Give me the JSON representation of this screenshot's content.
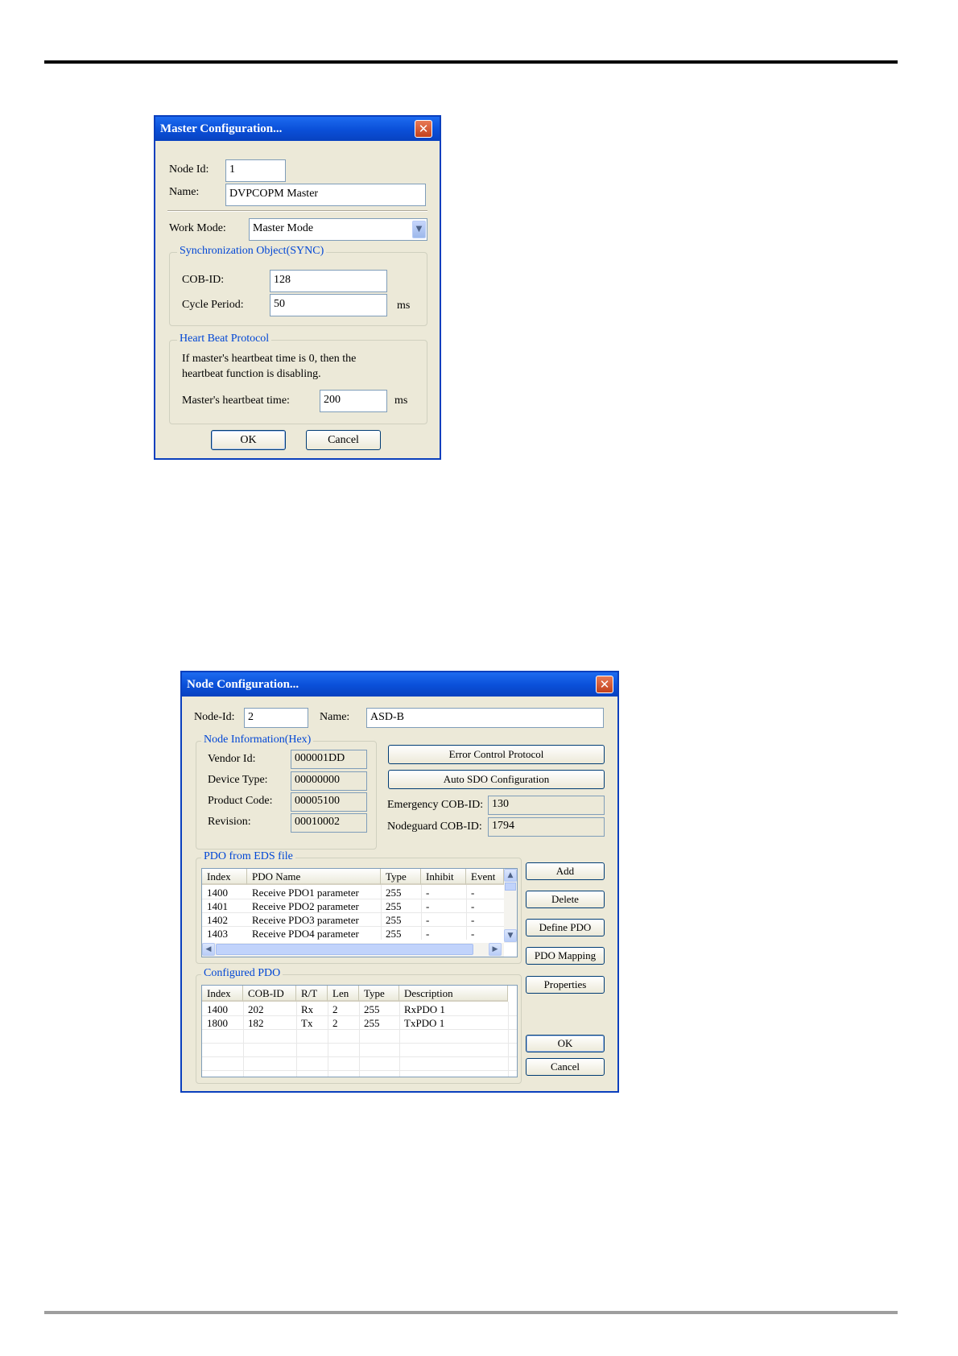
{
  "master_dialog": {
    "title": "Master Configuration...",
    "close_symbol": "✕",
    "node_id_label": "Node Id:",
    "node_id_value": "1",
    "name_label": "Name:",
    "name_value": "DVPCOPM Master",
    "work_mode_label": "Work Mode:",
    "work_mode_value": "Master Mode",
    "sync_group_title": "Synchronization Object(SYNC)",
    "cob_id_label": "COB-ID:",
    "cob_id_value": "128",
    "cycle_period_label": "Cycle Period:",
    "cycle_period_value": "50",
    "cycle_unit": "ms",
    "heartbeat_group_title": "Heart Beat Protocol",
    "heartbeat_note_line1": "If master's heartbeat time is 0, then the",
    "heartbeat_note_line2": "heartbeat function is disabling.",
    "heartbeat_time_label": "Master's heartbeat time:",
    "heartbeat_time_value": "200",
    "heartbeat_unit": "ms",
    "ok_label": "OK",
    "cancel_label": "Cancel"
  },
  "node_dialog": {
    "title": "Node Configuration...",
    "close_symbol": "✕",
    "node_id_label": "Node-Id:",
    "node_id_value": "2",
    "name_label": "Name:",
    "name_value": "ASD-B",
    "node_info_title": "Node Information(Hex)",
    "vendor_id_label": "Vendor Id:",
    "vendor_id_value": "000001DD",
    "device_type_label": "Device Type:",
    "device_type_value": "00000000",
    "product_code_label": "Product Code:",
    "product_code_value": "00005100",
    "revision_label": "Revision:",
    "revision_value": "00010002",
    "error_control_button": "Error Control Protocol",
    "auto_sdo_button": "Auto SDO Configuration",
    "emergency_label": "Emergency COB-ID:",
    "emergency_value": "130",
    "nodeguard_label": "Nodeguard COB-ID:",
    "nodeguard_value": "1794",
    "pdo_eds_title": "PDO from EDS file",
    "pdo_eds_headers": [
      "Index",
      "PDO Name",
      "Type",
      "Inhibit",
      "Event"
    ],
    "pdo_eds_rows": [
      [
        "1400",
        "Receive PDO1 parameter",
        "255",
        "-",
        "-"
      ],
      [
        "1401",
        "Receive PDO2 parameter",
        "255",
        "-",
        "-"
      ],
      [
        "1402",
        "Receive PDO3 parameter",
        "255",
        "-",
        "-"
      ],
      [
        "1403",
        "Receive PDO4 parameter",
        "255",
        "-",
        "-"
      ]
    ],
    "configured_title": "Configured PDO",
    "configured_headers": [
      "Index",
      "COB-ID",
      "R/T",
      "Len",
      "Type",
      "Description"
    ],
    "configured_rows": [
      [
        "1400",
        "202",
        "Rx",
        "2",
        "255",
        "RxPDO 1"
      ],
      [
        "1800",
        "182",
        "Tx",
        "2",
        "255",
        "TxPDO 1"
      ]
    ],
    "add_label": "Add",
    "delete_label": "Delete",
    "define_pdo_label": "Define PDO",
    "pdo_mapping_label": "PDO Mapping",
    "properties_label": "Properties",
    "ok_label": "OK",
    "cancel_label": "Cancel"
  }
}
